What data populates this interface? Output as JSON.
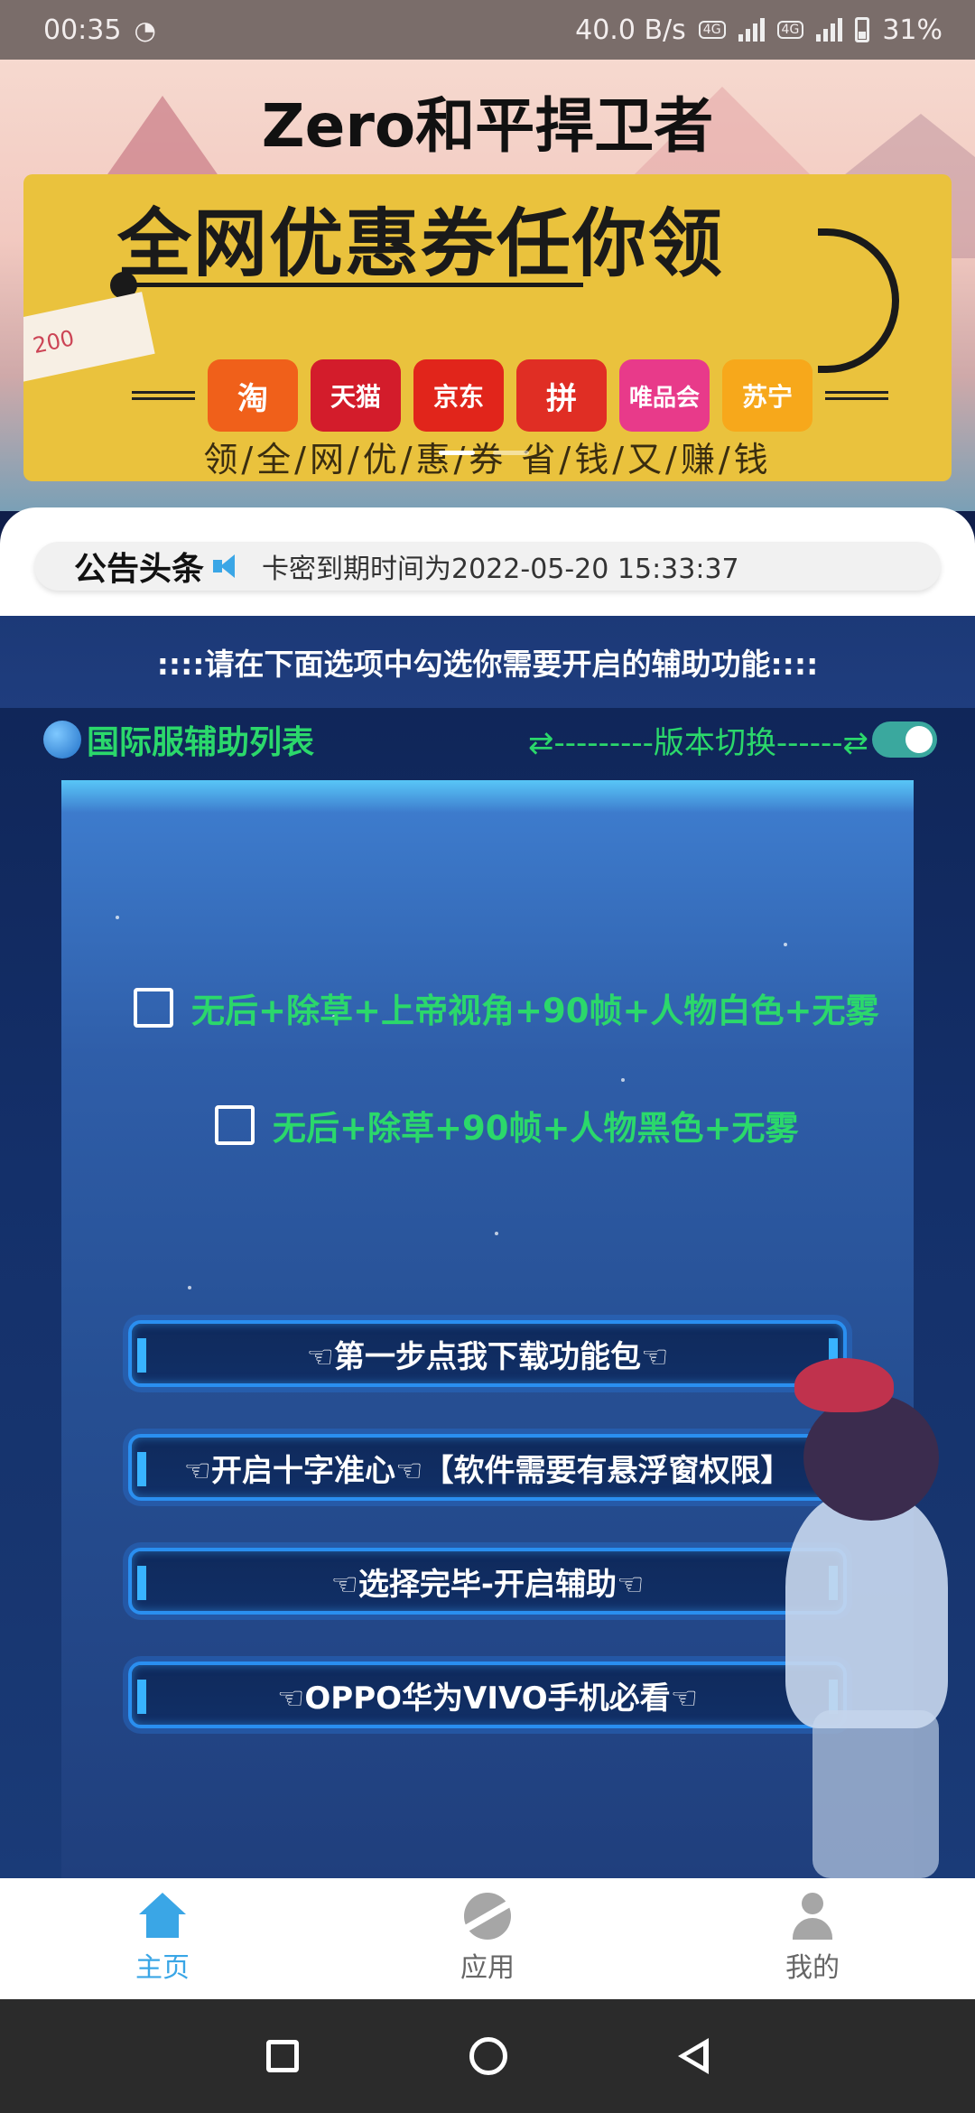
{
  "status_bar": {
    "time": "00:35",
    "net_speed": "40.0 B/s",
    "network_badge": "4G",
    "battery": "31%"
  },
  "header": {
    "title": "Zero和平捍卫者"
  },
  "banner": {
    "headline": "全网优惠券任你领",
    "coupon_text": "200",
    "stores": [
      "淘",
      "天猫",
      "京东",
      "拼",
      "唯品会",
      "苏宁"
    ],
    "slogan": "领/全/网/优/惠/券 省/钱/又/赚/钱"
  },
  "notice": {
    "label": "公告头条",
    "text": "卡密到期时间为2022-05-20 15:33:37"
  },
  "instruction": "::::请在下面选项中勾选你需要开启的辅助功能::::",
  "list": {
    "title": "国际服辅助列表",
    "switch_label": "⇄---------版本切换------⇄",
    "toggle_on": true
  },
  "options": [
    {
      "label": "无后+除草+上帝视角+90帧+人物白色+无雾",
      "checked": false
    },
    {
      "label": "无后+除草+90帧+人物黑色+无雾",
      "checked": false
    }
  ],
  "actions": [
    {
      "label": "☜第一步点我下载功能包☜"
    },
    {
      "label": "☜开启十字准心☜【软件需要有悬浮窗权限】"
    },
    {
      "label": "☜选择完毕-开启辅助☜"
    },
    {
      "label": "☜OPPO华为VIVO手机必看☜"
    }
  ],
  "tabbar": {
    "items": [
      {
        "label": "主页",
        "icon": "home-icon",
        "active": true
      },
      {
        "label": "应用",
        "icon": "planet-icon",
        "active": false
      },
      {
        "label": "我的",
        "icon": "user-icon",
        "active": false
      }
    ]
  },
  "colors": {
    "accent": "#3aa6e6",
    "option_green": "#2bd86b",
    "banner_yellow": "#eac23d"
  }
}
